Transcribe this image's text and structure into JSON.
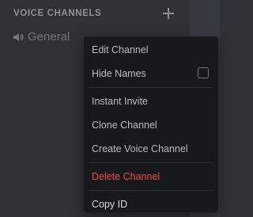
{
  "section": {
    "title": "VOICE CHANNELS",
    "add_icon": "plus-icon"
  },
  "channel": {
    "name": "General",
    "icon": "speaker-icon"
  },
  "context_menu": {
    "edit_channel": "Edit Channel",
    "hide_names": "Hide Names",
    "hide_names_checked": false,
    "instant_invite": "Instant Invite",
    "clone_channel": "Clone Channel",
    "create_voice_channel": "Create Voice Channel",
    "delete_channel": "Delete Channel",
    "copy_id": "Copy ID"
  },
  "colors": {
    "sidebar_bg": "#2f3136",
    "menu_bg": "#18191c",
    "danger": "#f04747",
    "muted_text": "#8e9297"
  }
}
